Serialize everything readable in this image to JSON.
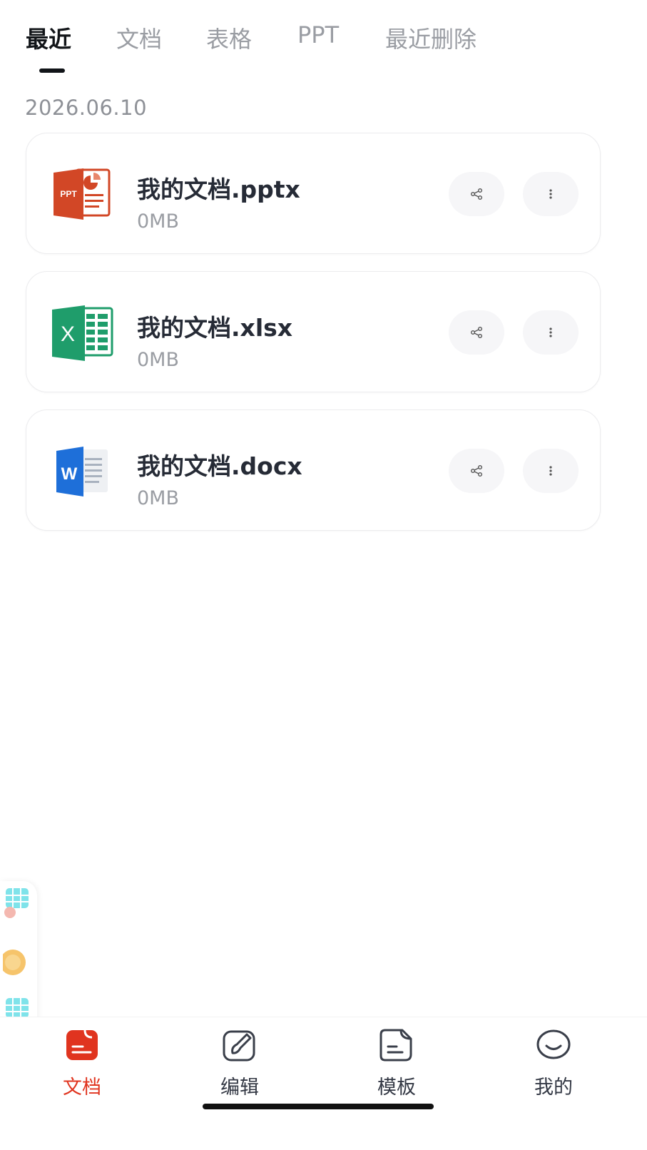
{
  "tabs": [
    {
      "label": "最近",
      "active": true
    },
    {
      "label": "文档",
      "active": false
    },
    {
      "label": "表格",
      "active": false
    },
    {
      "label": "PPT",
      "active": false
    },
    {
      "label": "最近删除",
      "active": false
    }
  ],
  "date": "2026.06.10",
  "files": [
    {
      "name": "我的文档.pptx",
      "size": "0MB",
      "type_icon": "ppt-file-icon",
      "icon_label": "PPT"
    },
    {
      "name": "我的文档.xlsx",
      "size": "0MB",
      "type_icon": "excel-file-icon",
      "icon_label": "X"
    },
    {
      "name": "我的文档.docx",
      "size": "0MB",
      "type_icon": "word-file-icon",
      "icon_label": "W"
    }
  ],
  "bottom_nav": [
    {
      "label": "文档",
      "icon": "document-icon",
      "active": true
    },
    {
      "label": "编辑",
      "icon": "edit-brush-icon",
      "active": false
    },
    {
      "label": "模板",
      "icon": "template-icon",
      "active": false
    },
    {
      "label": "我的",
      "icon": "profile-smile-icon",
      "active": false
    }
  ],
  "colors": {
    "accent_red": "#e0341f",
    "ppt_orange": "#d24726",
    "excel_green": "#1f9d6b",
    "word_blue": "#1e6fd9"
  }
}
